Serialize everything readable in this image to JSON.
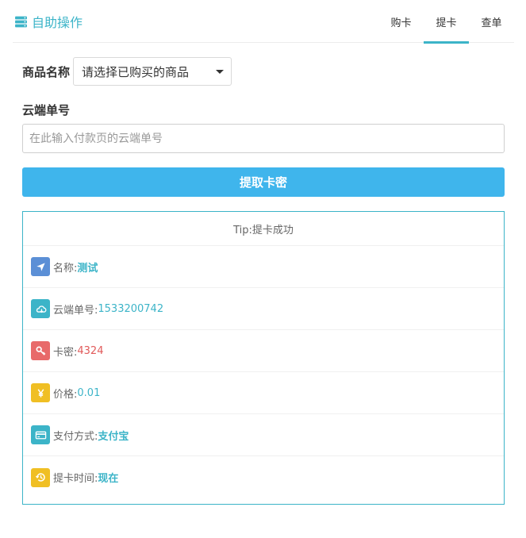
{
  "header": {
    "brand_title": "自助操作",
    "tabs": [
      {
        "label": "购卡",
        "active": false
      },
      {
        "label": "提卡",
        "active": true
      },
      {
        "label": "查单",
        "active": false
      }
    ]
  },
  "form": {
    "product_label": "商品名称",
    "product_select_value": "请选择已购买的商品",
    "order_label": "云端单号",
    "order_placeholder": "在此输入付款页的云端单号",
    "submit_label": "提取卡密"
  },
  "result": {
    "tip": "Tip:提卡成功",
    "items": [
      {
        "key": "名称: ",
        "value": "测试",
        "icon": "location-arrow-icon",
        "icon_color": "#5b8fd6",
        "value_color": "#3cb4c8"
      },
      {
        "key": "云端单号: ",
        "value": "1533200742",
        "icon": "cloud-download-icon",
        "icon_color": "#3cb4c8",
        "value_color": "#3cb4c8"
      },
      {
        "key": "卡密: ",
        "value": "4324",
        "icon": "key-icon",
        "icon_color": "#e86a6a",
        "value_color": "#e15a5a"
      },
      {
        "key": "价格:",
        "value": "0.01",
        "icon": "yen-icon",
        "icon_color": "#f0bf24",
        "value_color": "#3cb4c8"
      },
      {
        "key": "支付方式:",
        "value": "支付宝",
        "icon": "credit-card-icon",
        "icon_color": "#3cb4c8",
        "value_color": "#3cb4c8"
      },
      {
        "key": "提卡时间:",
        "value": "现在",
        "icon": "history-icon",
        "icon_color": "#f0bf24",
        "value_color": "#3cb4c8"
      }
    ]
  },
  "colors": {
    "accent": "#3cb4c8",
    "button": "#3fb5ec",
    "secret": "#e15a5a"
  }
}
